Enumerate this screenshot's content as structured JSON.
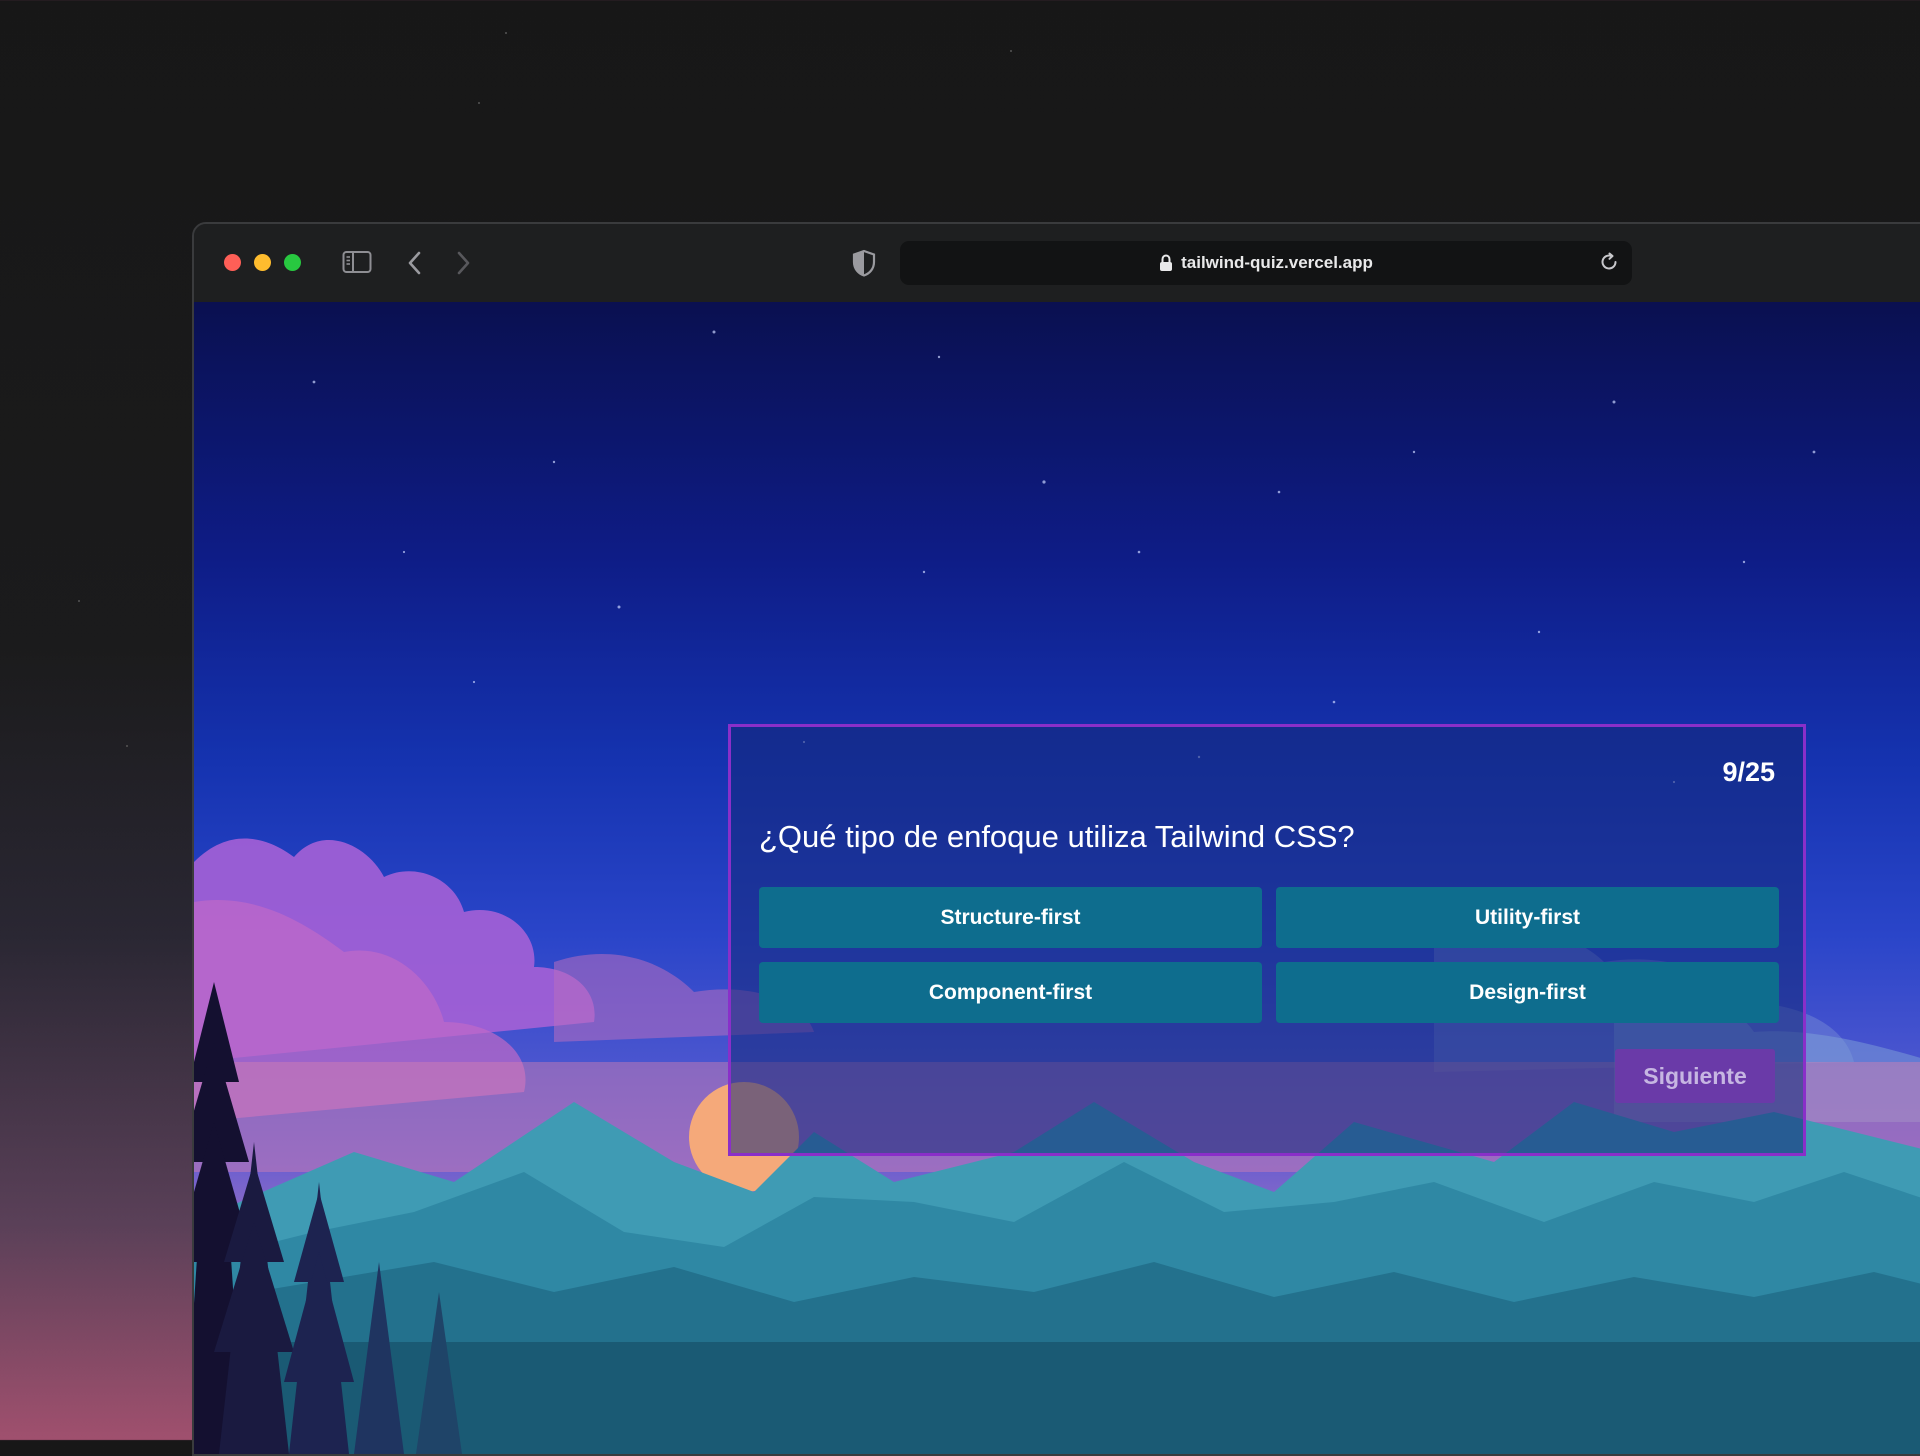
{
  "browser": {
    "url": "tailwind-quiz.vercel.app",
    "icons": [
      "sidebar-icon",
      "back-icon",
      "forward-icon",
      "shield-icon",
      "lock-icon",
      "reload-icon"
    ]
  },
  "quiz": {
    "counter": "9/25",
    "question": "¿Qué tipo de enfoque utiliza Tailwind CSS?",
    "answers": [
      "Structure-first",
      "Utility-first",
      "Component-first",
      "Design-first"
    ],
    "next_label": "Siguiente"
  },
  "colors": {
    "card_border": "#8a2fc9",
    "answer_bg": "#0e6d8e",
    "next_bg": "#6a3aa8"
  }
}
